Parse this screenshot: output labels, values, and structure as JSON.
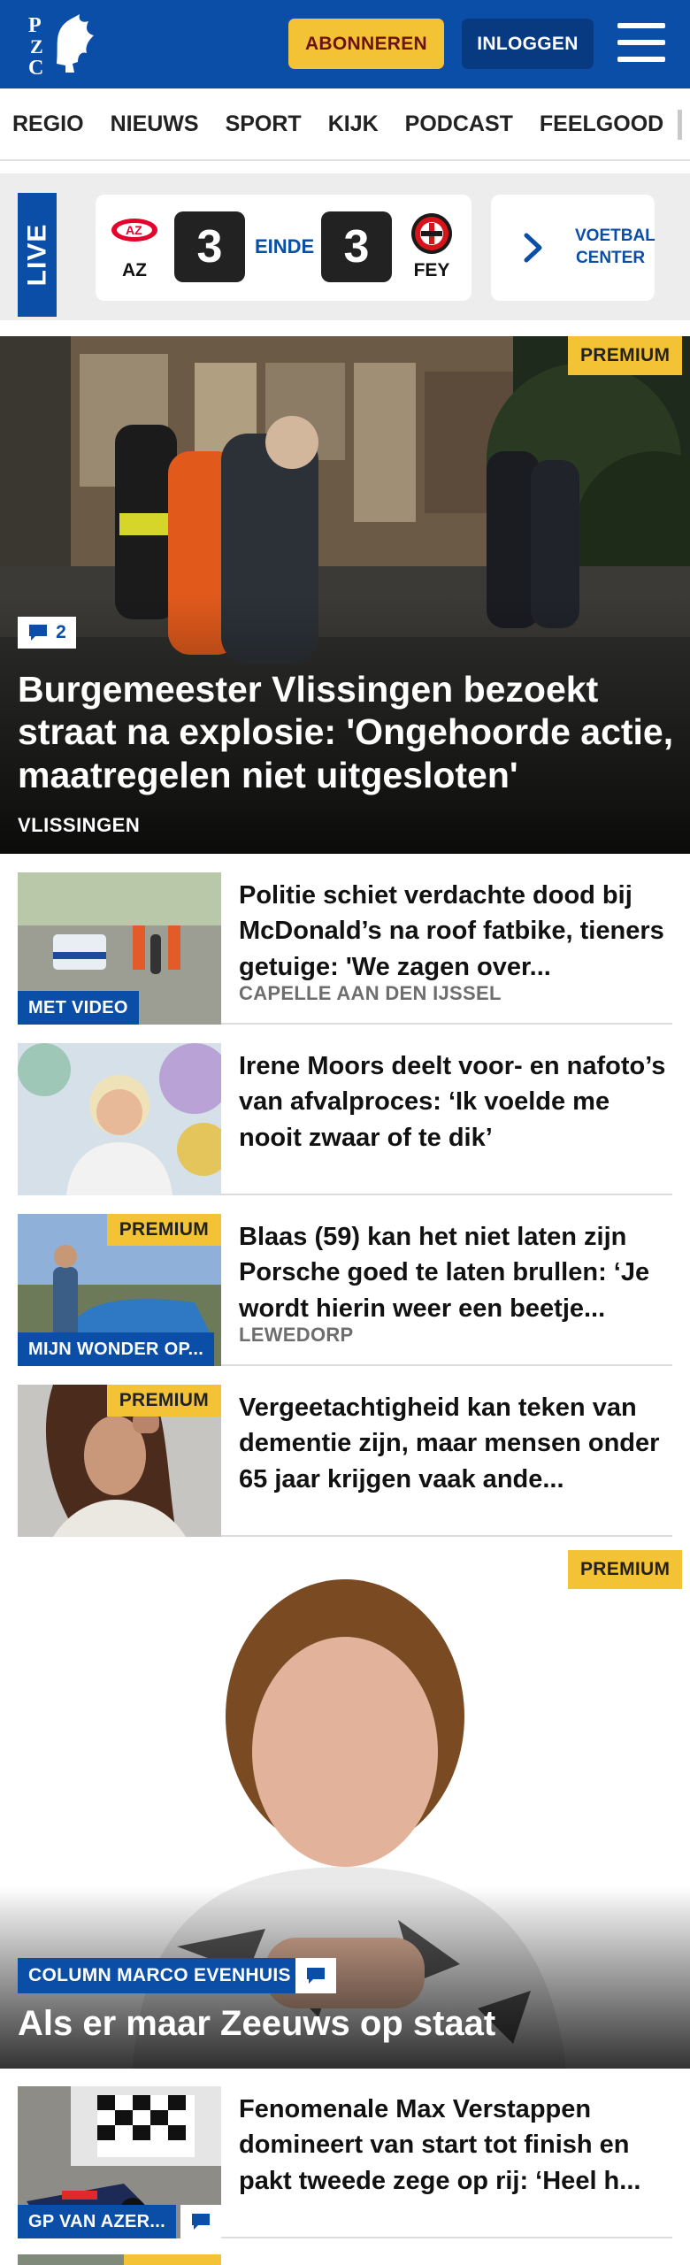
{
  "header": {
    "logo_text": "PZC",
    "subscribe_label": "ABONNEREN",
    "login_label": "INLOGGEN",
    "brand_color": "#0a4ea8",
    "accent_color": "#f4c235"
  },
  "nav": {
    "items": [
      "REGIO",
      "NIEUWS",
      "SPORT",
      "KIJK",
      "PODCAST",
      "FEELGOOD"
    ]
  },
  "live": {
    "tab_label": "LIVE",
    "match": {
      "home": "AZ",
      "home_score": "3",
      "status": "EINDE",
      "away_score": "3",
      "away": "FEY"
    },
    "voetbal_center_label": "VOETBAL CENTER"
  },
  "hero": {
    "premium_label": "PREMIUM",
    "comment_count": "2",
    "title": "Burgemeester Vlissingen bezoekt straat na explosie: 'Ongehoorde actie, maatregelen niet uitgesloten'",
    "region": "VLISSINGEN"
  },
  "articles": [
    {
      "title": "Politie schiet verdachte dood bij McDonald’s na roof fatbike, tieners getuige: 'We zagen over...",
      "region": "CAPELLE AAN DEN IJSSEL",
      "label": "MET VIDEO"
    },
    {
      "title": "Irene Moors deelt voor- en nafoto’s van afvalproces: ‘Ik voelde me nooit zwaar of te dik’"
    },
    {
      "title": "Blaas (59) kan het niet laten zijn Porsche goed te laten brullen: ‘Je wordt hierin weer een beetje...",
      "region": "LEWEDORP",
      "label": "MIJN WONDER OP...",
      "premium": "PREMIUM"
    },
    {
      "title": "Vergeetachtigheid kan teken van dementie zijn, maar mensen onder 65 jaar krijgen vaak ande...",
      "premium": "PREMIUM"
    }
  ],
  "column": {
    "premium_label": "PREMIUM",
    "label": "COLUMN MARCO EVENHUIS",
    "title": "Als er maar Zeeuws op staat"
  },
  "bottom_article": {
    "title": "Fenomenale Max Verstappen domineert van start tot finish en pakt tweede zege op rij: ‘Heel h...",
    "label": "GP VAN AZER..."
  }
}
